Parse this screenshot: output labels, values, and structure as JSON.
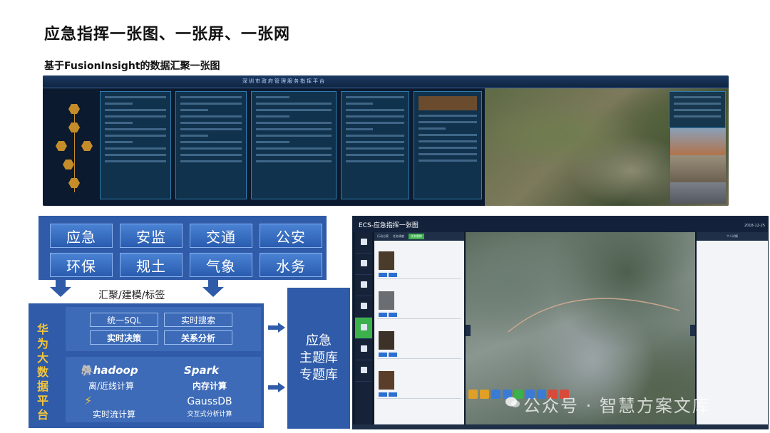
{
  "page": {
    "title": "应急指挥一张图、一张屏、一张网",
    "subtitle": "基于FusionInsight的数据汇聚一张图"
  },
  "wall": {
    "title": "深圳市政府管理服务指挥平台"
  },
  "diagram": {
    "categories": [
      "应急",
      "安监",
      "交通",
      "公安",
      "环保",
      "规土",
      "气象",
      "水务"
    ],
    "process_label": "汇聚/建模/标签",
    "platform_label": "华为大数据平台",
    "tools": [
      "统一SQL",
      "实时搜索",
      "实时决策",
      "关系分析"
    ],
    "engines": {
      "hadoop_logo": "hadoop",
      "hadoop_caption": "离/近线计算",
      "spark_logo": "Spark",
      "spark_caption": "内存计算",
      "stream_caption": "实时流计算",
      "gauss_name": "GaussDB",
      "gauss_caption": "交互式分析计算"
    },
    "topic_lines": [
      "应急",
      "主题库",
      "专题库"
    ]
  },
  "screenshot": {
    "title": "ECS-应急指挥一张图",
    "tabs": [
      "行动方案",
      "任务调度",
      "任务跟踪"
    ],
    "active_tab": "任务跟踪",
    "right_panel_header": "个人详情",
    "datetime": "2018-12-25"
  },
  "watermark": "公众号 · 智慧方案文库",
  "colors": {
    "diagram_blue": "#2f5ba8",
    "platform_text": "#f3c43a",
    "active_green": "#3cb04b"
  }
}
